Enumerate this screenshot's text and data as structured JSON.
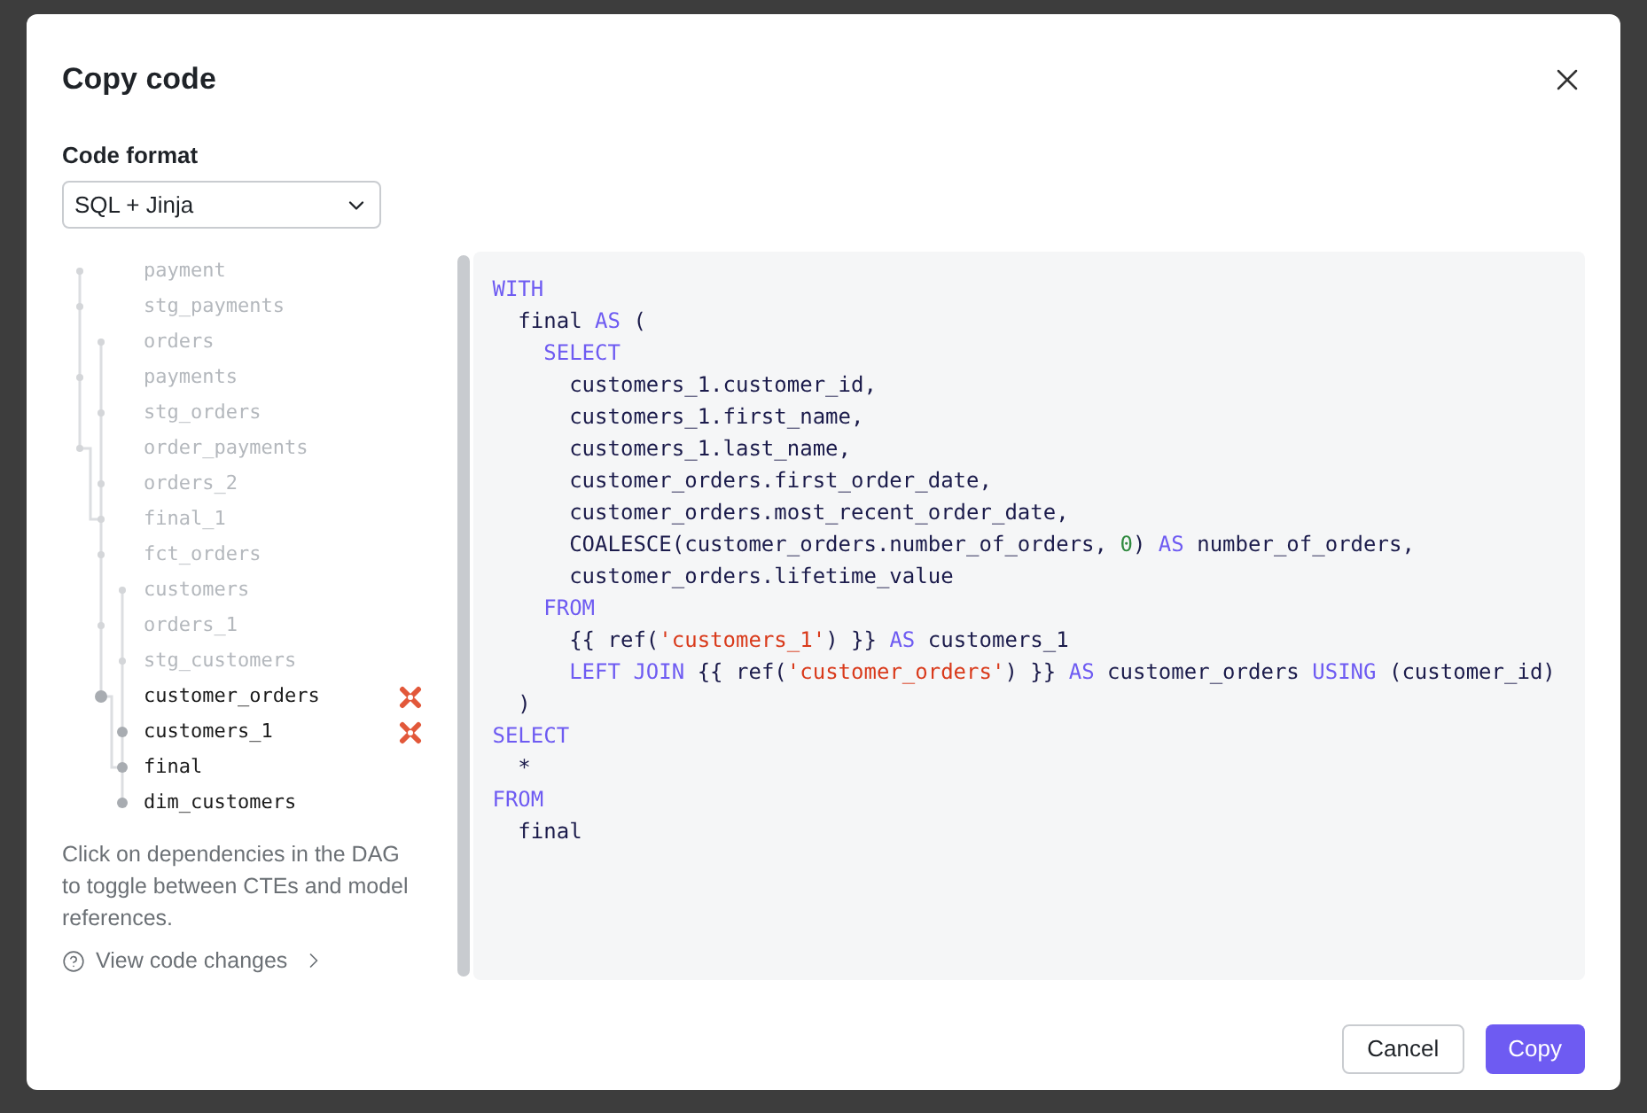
{
  "dialog": {
    "title": "Copy code"
  },
  "code_format": {
    "label": "Code format",
    "value": "SQL + Jinja"
  },
  "dag": [
    {
      "name": "payment",
      "active": false,
      "flagged": false
    },
    {
      "name": "stg_payments",
      "active": false,
      "flagged": false
    },
    {
      "name": "orders",
      "active": false,
      "flagged": false
    },
    {
      "name": "payments",
      "active": false,
      "flagged": false
    },
    {
      "name": "stg_orders",
      "active": false,
      "flagged": false
    },
    {
      "name": "order_payments",
      "active": false,
      "flagged": false
    },
    {
      "name": "orders_2",
      "active": false,
      "flagged": false
    },
    {
      "name": "final_1",
      "active": false,
      "flagged": false
    },
    {
      "name": "fct_orders",
      "active": false,
      "flagged": false
    },
    {
      "name": "customers",
      "active": false,
      "flagged": false
    },
    {
      "name": "orders_1",
      "active": false,
      "flagged": false
    },
    {
      "name": "stg_customers",
      "active": false,
      "flagged": false
    },
    {
      "name": "customer_orders",
      "active": true,
      "flagged": true
    },
    {
      "name": "customers_1",
      "active": true,
      "flagged": true
    },
    {
      "name": "final",
      "active": true,
      "flagged": false
    },
    {
      "name": "dim_customers",
      "active": true,
      "flagged": false
    }
  ],
  "hint": "Click on dependencies in the DAG to toggle between CTEs and model references.",
  "view_changes_link": "View code changes",
  "code": [
    [
      {
        "kind": "kw",
        "text": "WITH"
      }
    ],
    [
      {
        "kind": "plain",
        "text": "  final "
      },
      {
        "kind": "kw",
        "text": "AS"
      },
      {
        "kind": "plain",
        "text": " ("
      }
    ],
    [
      {
        "kind": "kw",
        "text": "    SELECT"
      }
    ],
    [
      {
        "kind": "plain",
        "text": "      customers_1.customer_id,"
      }
    ],
    [
      {
        "kind": "plain",
        "text": "      customers_1.first_name,"
      }
    ],
    [
      {
        "kind": "plain",
        "text": "      customers_1.last_name,"
      }
    ],
    [
      {
        "kind": "plain",
        "text": "      customer_orders.first_order_date,"
      }
    ],
    [
      {
        "kind": "plain",
        "text": "      customer_orders.most_recent_order_date,"
      }
    ],
    [
      {
        "kind": "plain",
        "text": "      COALESCE(customer_orders.number_of_orders, "
      },
      {
        "kind": "num",
        "text": "0"
      },
      {
        "kind": "plain",
        "text": ") "
      },
      {
        "kind": "kw",
        "text": "AS"
      },
      {
        "kind": "plain",
        "text": " number_of_orders,"
      }
    ],
    [
      {
        "kind": "plain",
        "text": "      customer_orders.lifetime_value"
      }
    ],
    [
      {
        "kind": "kw",
        "text": "    FROM"
      }
    ],
    [
      {
        "kind": "plain",
        "text": "      {{ ref("
      },
      {
        "kind": "str",
        "text": "'customers_1'"
      },
      {
        "kind": "plain",
        "text": ") }} "
      },
      {
        "kind": "kw",
        "text": "AS"
      },
      {
        "kind": "plain",
        "text": " customers_1"
      }
    ],
    [
      {
        "kind": "kw",
        "text": "      LEFT JOIN"
      },
      {
        "kind": "plain",
        "text": " {{ ref("
      },
      {
        "kind": "str",
        "text": "'customer_orders'"
      },
      {
        "kind": "plain",
        "text": ") }} "
      },
      {
        "kind": "kw",
        "text": "AS"
      },
      {
        "kind": "plain",
        "text": " customer_orders "
      },
      {
        "kind": "kw",
        "text": "USING"
      },
      {
        "kind": "plain",
        "text": " (customer_id)"
      }
    ],
    [
      {
        "kind": "plain",
        "text": "  )"
      }
    ],
    [
      {
        "kind": "kw",
        "text": "SELECT"
      }
    ],
    [
      {
        "kind": "plain",
        "text": "  *"
      }
    ],
    [
      {
        "kind": "kw",
        "text": "FROM"
      }
    ],
    [
      {
        "kind": "plain",
        "text": "  final"
      }
    ]
  ],
  "buttons": {
    "cancel": "Cancel",
    "copy": "Copy"
  }
}
